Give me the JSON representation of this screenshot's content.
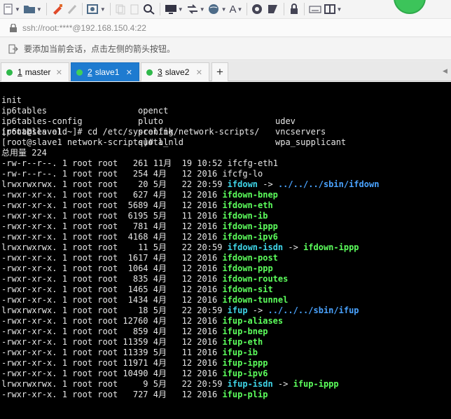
{
  "toolbar": {
    "buttons": [
      "new-session",
      "open-folder",
      "compose",
      "pen-disabled",
      "connect-settings",
      "copy-disabled",
      "paste-disabled",
      "find",
      "monitor",
      "transfer",
      "globe",
      "font-size",
      "record",
      "xshell",
      "lock",
      "keyboard",
      "window-layout"
    ],
    "font_size_label": "A"
  },
  "address": {
    "text": "ssh://root:****@192.168.150.4:22"
  },
  "hint": {
    "text": "要添加当前会话，点击左侧的箭头按钮。"
  },
  "tabs": [
    {
      "num": "1",
      "label": "master",
      "active": false
    },
    {
      "num": "2",
      "label": "slave1",
      "active": true
    },
    {
      "num": "3",
      "label": "slave2",
      "active": false
    }
  ],
  "terminal": {
    "columns_rows": [
      [
        "init",
        "openct",
        "udev"
      ],
      [
        "ip6tables",
        "pluto",
        "vncservers"
      ],
      [
        "ip6tables-config",
        "prelink",
        "wpa_supplicant"
      ],
      [
        "ip6tables.old",
        "quota_nld",
        ""
      ]
    ],
    "cmd1": "[root@slave1 ~]# cd /etc/sysconfig/network-scripts/",
    "cmd2": "[root@slave1 network-scripts]# ll",
    "total": "总用量 224",
    "listing": [
      {
        "meta": "-rw-r--r--. 1 root root   261 11月  19 10:52 ",
        "name": "ifcfg-eth1",
        "color": "plain",
        "arrow": "",
        "target": "",
        "target_color": ""
      },
      {
        "meta": "-rw-r--r--. 1 root root   254 4月   12 2016 ",
        "name": "ifcfg-lo",
        "color": "plain",
        "arrow": "",
        "target": "",
        "target_color": ""
      },
      {
        "meta": "lrwxrwxrwx. 1 root root    20 5月   22 20:59 ",
        "name": "ifdown",
        "color": "cyan",
        "arrow": " -> ",
        "target": "../../../sbin/ifdown",
        "target_color": "blue"
      },
      {
        "meta": "-rwxr-xr-x. 1 root root   627 4月   12 2016 ",
        "name": "ifdown-bnep",
        "color": "green",
        "arrow": "",
        "target": "",
        "target_color": ""
      },
      {
        "meta": "-rwxr-xr-x. 1 root root  5689 4月   12 2016 ",
        "name": "ifdown-eth",
        "color": "green",
        "arrow": "",
        "target": "",
        "target_color": ""
      },
      {
        "meta": "-rwxr-xr-x. 1 root root  6195 5月   11 2016 ",
        "name": "ifdown-ib",
        "color": "green",
        "arrow": "",
        "target": "",
        "target_color": ""
      },
      {
        "meta": "-rwxr-xr-x. 1 root root   781 4月   12 2016 ",
        "name": "ifdown-ippp",
        "color": "green",
        "arrow": "",
        "target": "",
        "target_color": ""
      },
      {
        "meta": "-rwxr-xr-x. 1 root root  4168 4月   12 2016 ",
        "name": "ifdown-ipv6",
        "color": "green",
        "arrow": "",
        "target": "",
        "target_color": ""
      },
      {
        "meta": "lrwxrwxrwx. 1 root root    11 5月   22 20:59 ",
        "name": "ifdown-isdn",
        "color": "cyan",
        "arrow": " -> ",
        "target": "ifdown-ippp",
        "target_color": "green"
      },
      {
        "meta": "-rwxr-xr-x. 1 root root  1617 4月   12 2016 ",
        "name": "ifdown-post",
        "color": "green",
        "arrow": "",
        "target": "",
        "target_color": ""
      },
      {
        "meta": "-rwxr-xr-x. 1 root root  1064 4月   12 2016 ",
        "name": "ifdown-ppp",
        "color": "green",
        "arrow": "",
        "target": "",
        "target_color": ""
      },
      {
        "meta": "-rwxr-xr-x. 1 root root   835 4月   12 2016 ",
        "name": "ifdown-routes",
        "color": "green",
        "arrow": "",
        "target": "",
        "target_color": ""
      },
      {
        "meta": "-rwxr-xr-x. 1 root root  1465 4月   12 2016 ",
        "name": "ifdown-sit",
        "color": "green",
        "arrow": "",
        "target": "",
        "target_color": ""
      },
      {
        "meta": "-rwxr-xr-x. 1 root root  1434 4月   12 2016 ",
        "name": "ifdown-tunnel",
        "color": "green",
        "arrow": "",
        "target": "",
        "target_color": ""
      },
      {
        "meta": "lrwxrwxrwx. 1 root root    18 5月   22 20:59 ",
        "name": "ifup",
        "color": "cyan",
        "arrow": " -> ",
        "target": "../../../sbin/ifup",
        "target_color": "blue"
      },
      {
        "meta": "-rwxr-xr-x. 1 root root 12760 4月   12 2016 ",
        "name": "ifup-aliases",
        "color": "green",
        "arrow": "",
        "target": "",
        "target_color": ""
      },
      {
        "meta": "-rwxr-xr-x. 1 root root   859 4月   12 2016 ",
        "name": "ifup-bnep",
        "color": "green",
        "arrow": "",
        "target": "",
        "target_color": ""
      },
      {
        "meta": "-rwxr-xr-x. 1 root root 11359 4月   12 2016 ",
        "name": "ifup-eth",
        "color": "green",
        "arrow": "",
        "target": "",
        "target_color": ""
      },
      {
        "meta": "-rwxr-xr-x. 1 root root 11339 5月   11 2016 ",
        "name": "ifup-ib",
        "color": "green",
        "arrow": "",
        "target": "",
        "target_color": ""
      },
      {
        "meta": "-rwxr-xr-x. 1 root root 11971 4月   12 2016 ",
        "name": "ifup-ippp",
        "color": "green",
        "arrow": "",
        "target": "",
        "target_color": ""
      },
      {
        "meta": "-rwxr-xr-x. 1 root root 10490 4月   12 2016 ",
        "name": "ifup-ipv6",
        "color": "green",
        "arrow": "",
        "target": "",
        "target_color": ""
      },
      {
        "meta": "lrwxrwxrwx. 1 root root     9 5月   22 20:59 ",
        "name": "ifup-isdn",
        "color": "cyan",
        "arrow": " -> ",
        "target": "ifup-ippp",
        "target_color": "green"
      },
      {
        "meta": "-rwxr-xr-x. 1 root root   727 4月   12 2016 ",
        "name": "ifup-plip",
        "color": "green",
        "arrow": "",
        "target": "",
        "target_color": ""
      }
    ]
  }
}
